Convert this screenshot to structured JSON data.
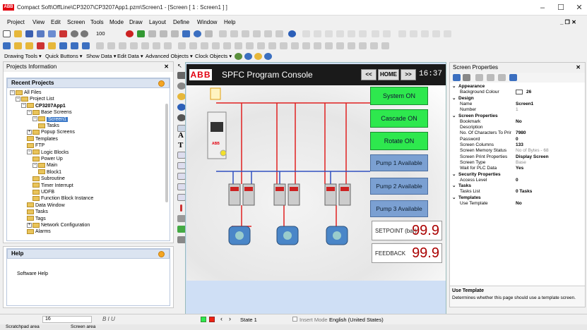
{
  "app": {
    "logo": "ABB",
    "title": "Compact Soft\\OffLine\\CP3207\\CP3207App1.pzm\\Screen1 - [Screen [ 1 : Screen1 ] ]"
  },
  "window_controls": [
    "–",
    "☐",
    "✕"
  ],
  "menu": [
    "Project",
    "View",
    "Edit",
    "Screen",
    "Tools",
    "Mode",
    "Draw",
    "Layout",
    "Define",
    "Window",
    "Help"
  ],
  "menu_right": "_ ❐ ✕",
  "toolbar": {
    "zoom": "100"
  },
  "drop_bar": [
    "Drawing Tools ▾",
    "Quick Buttons ▾",
    "Show Data ▾",
    "Edit Data ▾",
    "Advanced Objects ▾",
    "Clock Objects ▾"
  ],
  "project_panel": {
    "title": "Projects Information",
    "close": "✕",
    "section": "Recent Projects",
    "tree": [
      {
        "label": "All Files",
        "indent": 0,
        "box": "−"
      },
      {
        "label": "Project List",
        "indent": 1,
        "box": "−"
      },
      {
        "label": "CP3207App1",
        "indent": 2,
        "box": "−",
        "bold": true
      },
      {
        "label": "Base Screens",
        "indent": 3,
        "box": "−"
      },
      {
        "label": "Screen1",
        "indent": 4,
        "box": "−",
        "selected": true
      },
      {
        "label": "Tasks",
        "indent": 5,
        "box": ""
      },
      {
        "label": "Popup Screens",
        "indent": 3,
        "box": "+"
      },
      {
        "label": "Templates",
        "indent": 3,
        "box": ""
      },
      {
        "label": "FTP",
        "indent": 3,
        "box": ""
      },
      {
        "label": "Logic Blocks",
        "indent": 3,
        "box": "−"
      },
      {
        "label": "Power Up",
        "indent": 4,
        "box": ""
      },
      {
        "label": "Main",
        "indent": 4,
        "box": "−"
      },
      {
        "label": "Block1",
        "indent": 5,
        "box": ""
      },
      {
        "label": "Subroutine",
        "indent": 4,
        "box": ""
      },
      {
        "label": "Timer Interrupt",
        "indent": 4,
        "box": ""
      },
      {
        "label": "UDFB",
        "indent": 4,
        "box": ""
      },
      {
        "label": "Function Block Instance",
        "indent": 4,
        "box": ""
      },
      {
        "label": "Data Window",
        "indent": 3,
        "box": ""
      },
      {
        "label": "Tasks",
        "indent": 3,
        "box": ""
      },
      {
        "label": "Tags",
        "indent": 3,
        "box": ""
      },
      {
        "label": "Network Configuration",
        "indent": 3,
        "box": "+"
      },
      {
        "label": "Alarms",
        "indent": 3,
        "box": ""
      }
    ]
  },
  "help_panel": {
    "title": "Help",
    "text": "Software Help"
  },
  "hmi": {
    "logo": "ABB",
    "title": "SPFC Program Console",
    "prev": "<<",
    "home": "HOME",
    "next": ">>",
    "clock": "16:37",
    "buttons": [
      "System ON",
      "Cascade ON",
      "Rotate ON"
    ],
    "pumps": [
      "Pump 1 Available",
      "Pump 2 Available",
      "Pump 3 Available"
    ],
    "setpoint": {
      "label": "SETPOINT (bar)",
      "value": "99.9"
    },
    "feedback": {
      "label": "FEEDBACK",
      "value": "99.9"
    },
    "colors": {
      "green": "#2ee84e",
      "blue": "#7ba0d2",
      "red_line": "#e02020",
      "blue_line": "#3050c0"
    }
  },
  "properties": {
    "title": "Screen Properties",
    "close": "✕",
    "rows": [
      {
        "cat": "Appearance"
      },
      {
        "k": "Background Colour",
        "v": "26",
        "swatch": true
      },
      {
        "cat": "Design"
      },
      {
        "k": "Name",
        "v": "Screen1"
      },
      {
        "k": "Number",
        "v": "1",
        "grey": true
      },
      {
        "cat": "Screen Properties"
      },
      {
        "k": "Bookmark",
        "v": "No"
      },
      {
        "k": "Description",
        "v": ""
      },
      {
        "k": "No. Of Characters To Prir",
        "v": "7980"
      },
      {
        "k": "Password",
        "v": "0"
      },
      {
        "k": "Screen Columns",
        "v": "133"
      },
      {
        "k": "Screen Memory Status",
        "v": "No of Bytes - 68",
        "grey": true
      },
      {
        "k": "Screen Print Properties",
        "v": "Display Screen"
      },
      {
        "k": "Screen Type",
        "v": "Base",
        "grey": true
      },
      {
        "k": "Wait for PLC Data",
        "v": "Yes"
      },
      {
        "cat": "Security Properties"
      },
      {
        "k": "Access Level",
        "v": "0"
      },
      {
        "cat": "Tasks"
      },
      {
        "k": "Tasks List",
        "v": "0 Tasks"
      },
      {
        "cat": "Templates"
      },
      {
        "k": "Use Template",
        "v": "No"
      }
    ],
    "footer_title": "Use Template",
    "footer_text": "Determines whether this page should use a template screen."
  },
  "statusbar": {
    "font_size": "16",
    "format": "B  I  U",
    "state": "State 1",
    "insert_mode": "Insert Mode",
    "language": "English (United States)"
  },
  "bottom_tabs": [
    "Scratchpad area",
    "Screen area"
  ]
}
